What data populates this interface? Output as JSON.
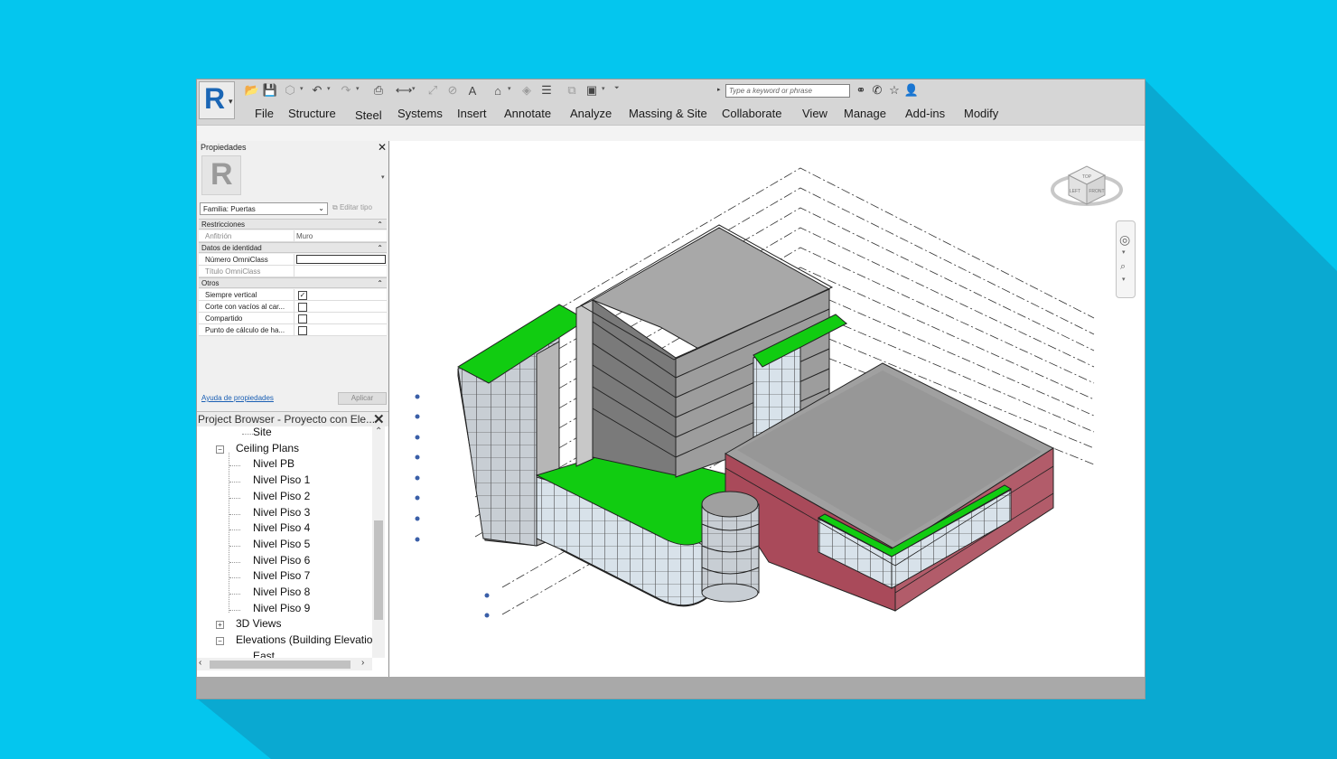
{
  "app": {
    "logo_letter": "R",
    "brand_color": "#1b66b5",
    "background_color": "#04c6ee"
  },
  "quick_access": {
    "icons": [
      "open-icon",
      "save-icon",
      "sync-icon",
      "undo-icon",
      "redo-icon",
      "print-icon",
      "measure-icon",
      "dimension-icon",
      "tag-icon",
      "text-icon",
      "3d-view-icon",
      "section-icon",
      "thin-lines-icon",
      "close-hidden-icon",
      "switch-windows-icon",
      "customize-icon"
    ]
  },
  "search": {
    "placeholder": "Type a keyword or phrase"
  },
  "title_icons": [
    "binoculars-icon",
    "communication-icon",
    "favorites-icon",
    "user-icon"
  ],
  "tabs": [
    "File",
    "Structure",
    "Steel",
    "Systems",
    "Insert",
    "Annotate",
    "Analyze",
    "Massing & Site",
    "Collaborate",
    "View",
    "Manage",
    "Add-ins",
    "Modify"
  ],
  "properties": {
    "title": "Propiedades",
    "type_icon_letter": "R",
    "family": "Familia: Puertas",
    "edit_type": "Editar tipo",
    "groups": {
      "constraints": "Restricciones",
      "identity": "Datos de identidad",
      "other": "Otros"
    },
    "rows": {
      "host_label": "Anfitrión",
      "host_value": "Muro",
      "omniclass_number": "Número OmniClass",
      "omniclass_title": "Título OmniClass",
      "always_vertical": "Siempre vertical",
      "cut_with_voids": "Corte con vacíos al car...",
      "shared": "Compartido",
      "calc_point": "Punto de cálculo de ha..."
    },
    "checkboxes": {
      "always_vertical": true,
      "cut_with_voids": false,
      "shared": false,
      "calc_point": false
    },
    "help_link": "Ayuda de propiedades",
    "apply": "Aplicar"
  },
  "project_browser": {
    "title": "Project Browser - Proyecto con Ele...",
    "items": {
      "site": "Site",
      "ceiling_plans": "Ceiling Plans",
      "levels": [
        "Nivel PB",
        "Nivel Piso 1",
        "Nivel Piso 2",
        "Nivel Piso 3",
        "Nivel Piso 4",
        "Nivel Piso 5",
        "Nivel Piso 6",
        "Nivel Piso 7",
        "Nivel Piso 8",
        "Nivel Piso 9"
      ],
      "views_3d": "3D Views",
      "elevations": "Elevations (Building Elevation",
      "east": "East"
    }
  },
  "viewcube": {
    "top": "TOP",
    "left": "LEFT",
    "front": "FRONT"
  },
  "model_colors": {
    "roof_green": "#11cc11",
    "wall_gray": "#a8a8a8",
    "brick_red": "#a94a5a",
    "glass": "#d8e2ea"
  }
}
